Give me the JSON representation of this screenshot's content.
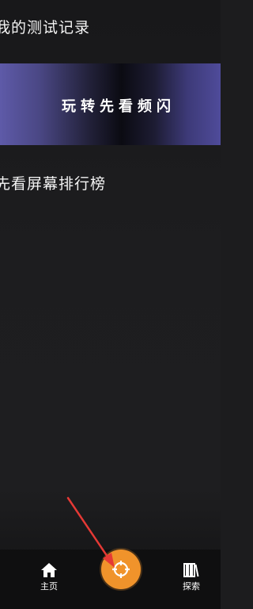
{
  "sections": {
    "records_title": "我的测试记录",
    "ranking_title": "先看屏幕排行榜"
  },
  "banner": {
    "text": "玩转先看频闪"
  },
  "bottom_nav": {
    "home": {
      "label": "主页",
      "icon": "home-icon"
    },
    "center": {
      "icon": "crosshair-icon",
      "color": "#f0932b"
    },
    "explore": {
      "label": "探索",
      "icon": "books-icon"
    }
  },
  "annotation": {
    "icon": "red-arrow",
    "color": "#e53935"
  }
}
